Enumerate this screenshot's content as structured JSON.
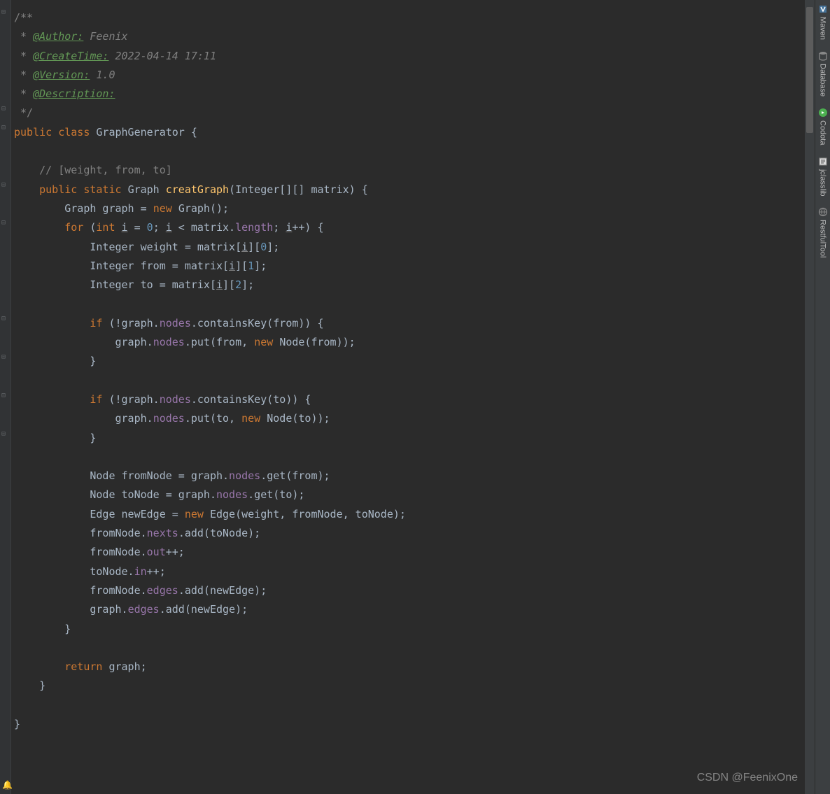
{
  "javadoc": {
    "open": "/**",
    "star": " * ",
    "author_tag": "@Author:",
    "author_val": " Feenix",
    "create_tag": "@CreateTime:",
    "create_val": " 2022-04-14 17:11",
    "version_tag": "@Version:",
    "version_val": " 1.0",
    "desc_tag": "@Description:",
    "close": " */"
  },
  "code": {
    "l1_public": "public ",
    "l1_class": "class ",
    "l1_name": "GraphGenerator ",
    "l1_brace": "{",
    "blank": "",
    "l2_comment": "    // [weight, from, to]",
    "l3_a": "    ",
    "l3_public": "public ",
    "l3_static": "static ",
    "l3_type": "Graph ",
    "l3_method": "creatGraph",
    "l3_params": "(Integer[][] matrix) {",
    "l4": "        Graph graph = ",
    "l4_new": "new ",
    "l4_b": "Graph();",
    "l5_a": "        ",
    "l5_for": "for ",
    "l5_b": "(",
    "l5_int": "int ",
    "l5_i": "i",
    "l5_c": " = ",
    "l5_zero": "0",
    "l5_d": "; ",
    "l5_i2": "i",
    "l5_e": " < matrix.",
    "l5_len": "length",
    "l5_f": "; ",
    "l5_i3": "i",
    "l5_g": "++) {",
    "l6_a": "            Integer weight = matrix[",
    "l6_i": "i",
    "l6_b": "][",
    "l6_n": "0",
    "l6_c": "];",
    "l7_a": "            Integer from = matrix[",
    "l7_i": "i",
    "l7_b": "][",
    "l7_n": "1",
    "l7_c": "];",
    "l8_a": "            Integer to = matrix[",
    "l8_i": "i",
    "l8_b": "][",
    "l8_n": "2",
    "l8_c": "];",
    "l10_a": "            ",
    "l10_if": "if ",
    "l10_b": "(!graph.",
    "l10_nodes": "nodes",
    "l10_c": ".containsKey(from)) {",
    "l11_a": "                graph.",
    "l11_nodes": "nodes",
    "l11_b": ".put(from, ",
    "l11_new": "new ",
    "l11_c": "Node(from));",
    "l12": "            }",
    "l14_a": "            ",
    "l14_if": "if ",
    "l14_b": "(!graph.",
    "l14_nodes": "nodes",
    "l14_c": ".containsKey(to)) {",
    "l15_a": "                graph.",
    "l15_nodes": "nodes",
    "l15_b": ".put(to, ",
    "l15_new": "new ",
    "l15_c": "Node(to));",
    "l16": "            }",
    "l18_a": "            Node fromNode = graph.",
    "l18_nodes": "nodes",
    "l18_b": ".get(from);",
    "l19_a": "            Node toNode = graph.",
    "l19_nodes": "nodes",
    "l19_b": ".get(to);",
    "l20_a": "            Edge newEdge = ",
    "l20_new": "new ",
    "l20_b": "Edge(weight, fromNode, toNode);",
    "l21_a": "            fromNode.",
    "l21_nexts": "nexts",
    "l21_b": ".add(toNode);",
    "l22_a": "            fromNode.",
    "l22_out": "out",
    "l22_b": "++;",
    "l23_a": "            toNode.",
    "l23_in": "in",
    "l23_b": "++;",
    "l24_a": "            fromNode.",
    "l24_edges": "edges",
    "l24_b": ".add(newEdge);",
    "l25_a": "            graph.",
    "l25_edges": "edges",
    "l25_b": ".add(newEdge);",
    "l26": "        }",
    "l28_a": "        ",
    "l28_return": "return ",
    "l28_b": "graph;",
    "l29": "    }",
    "l31": "}"
  },
  "tools": {
    "maven": "Maven",
    "database": "Database",
    "codota": "Codota",
    "jclasslib": "jclasslib",
    "restful": "RestfulTool"
  },
  "watermark": "CSDN @FeenixOne",
  "colors": {
    "bg": "#2b2b2b",
    "keyword": "#cc7832",
    "method": "#ffc66d",
    "field": "#9876aa",
    "number": "#6897bb",
    "comment": "#808080",
    "doctag": "#629755"
  }
}
